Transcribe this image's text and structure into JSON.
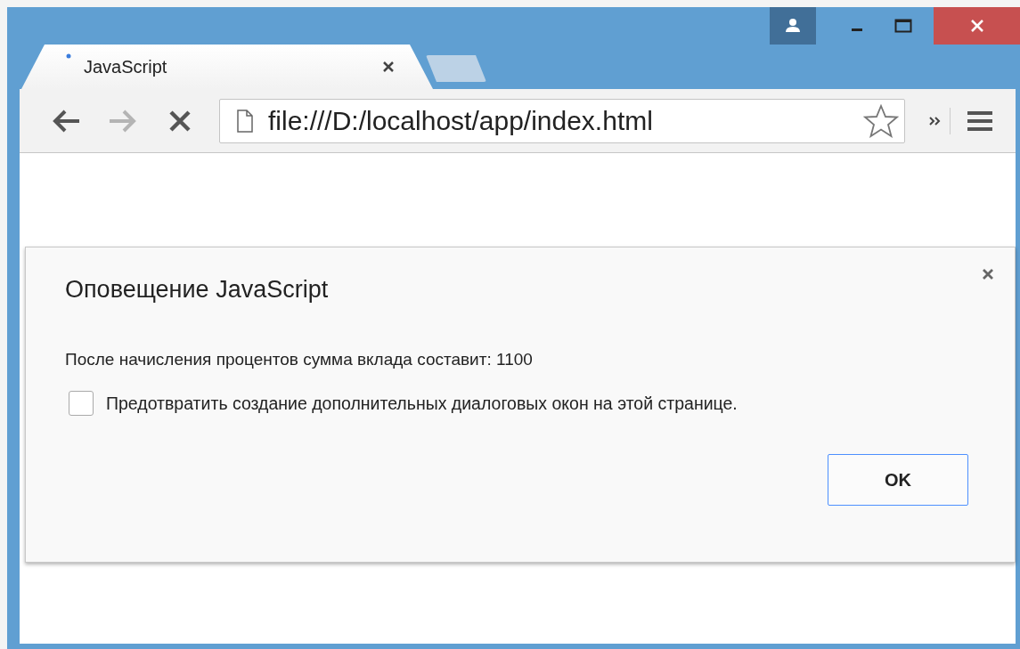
{
  "tabs": [
    {
      "label": "JavaScript",
      "selected": true
    }
  ],
  "toolbar": {
    "nav": [
      {
        "kind": "back",
        "disabled": false
      },
      {
        "kind": "forward",
        "disabled": true
      },
      {
        "kind": "stop",
        "disabled": false
      }
    ],
    "address": "file:///D:/localhost/app/index.html"
  },
  "dialog": {
    "title": "Оповещение JavaScript",
    "message": "После начисления процентов сумма вклада составит: 1100",
    "checkbox": {
      "label": "Предотвратить создание дополнительных диалоговых окон на этой странице.",
      "checked": false
    },
    "button": "OK"
  }
}
